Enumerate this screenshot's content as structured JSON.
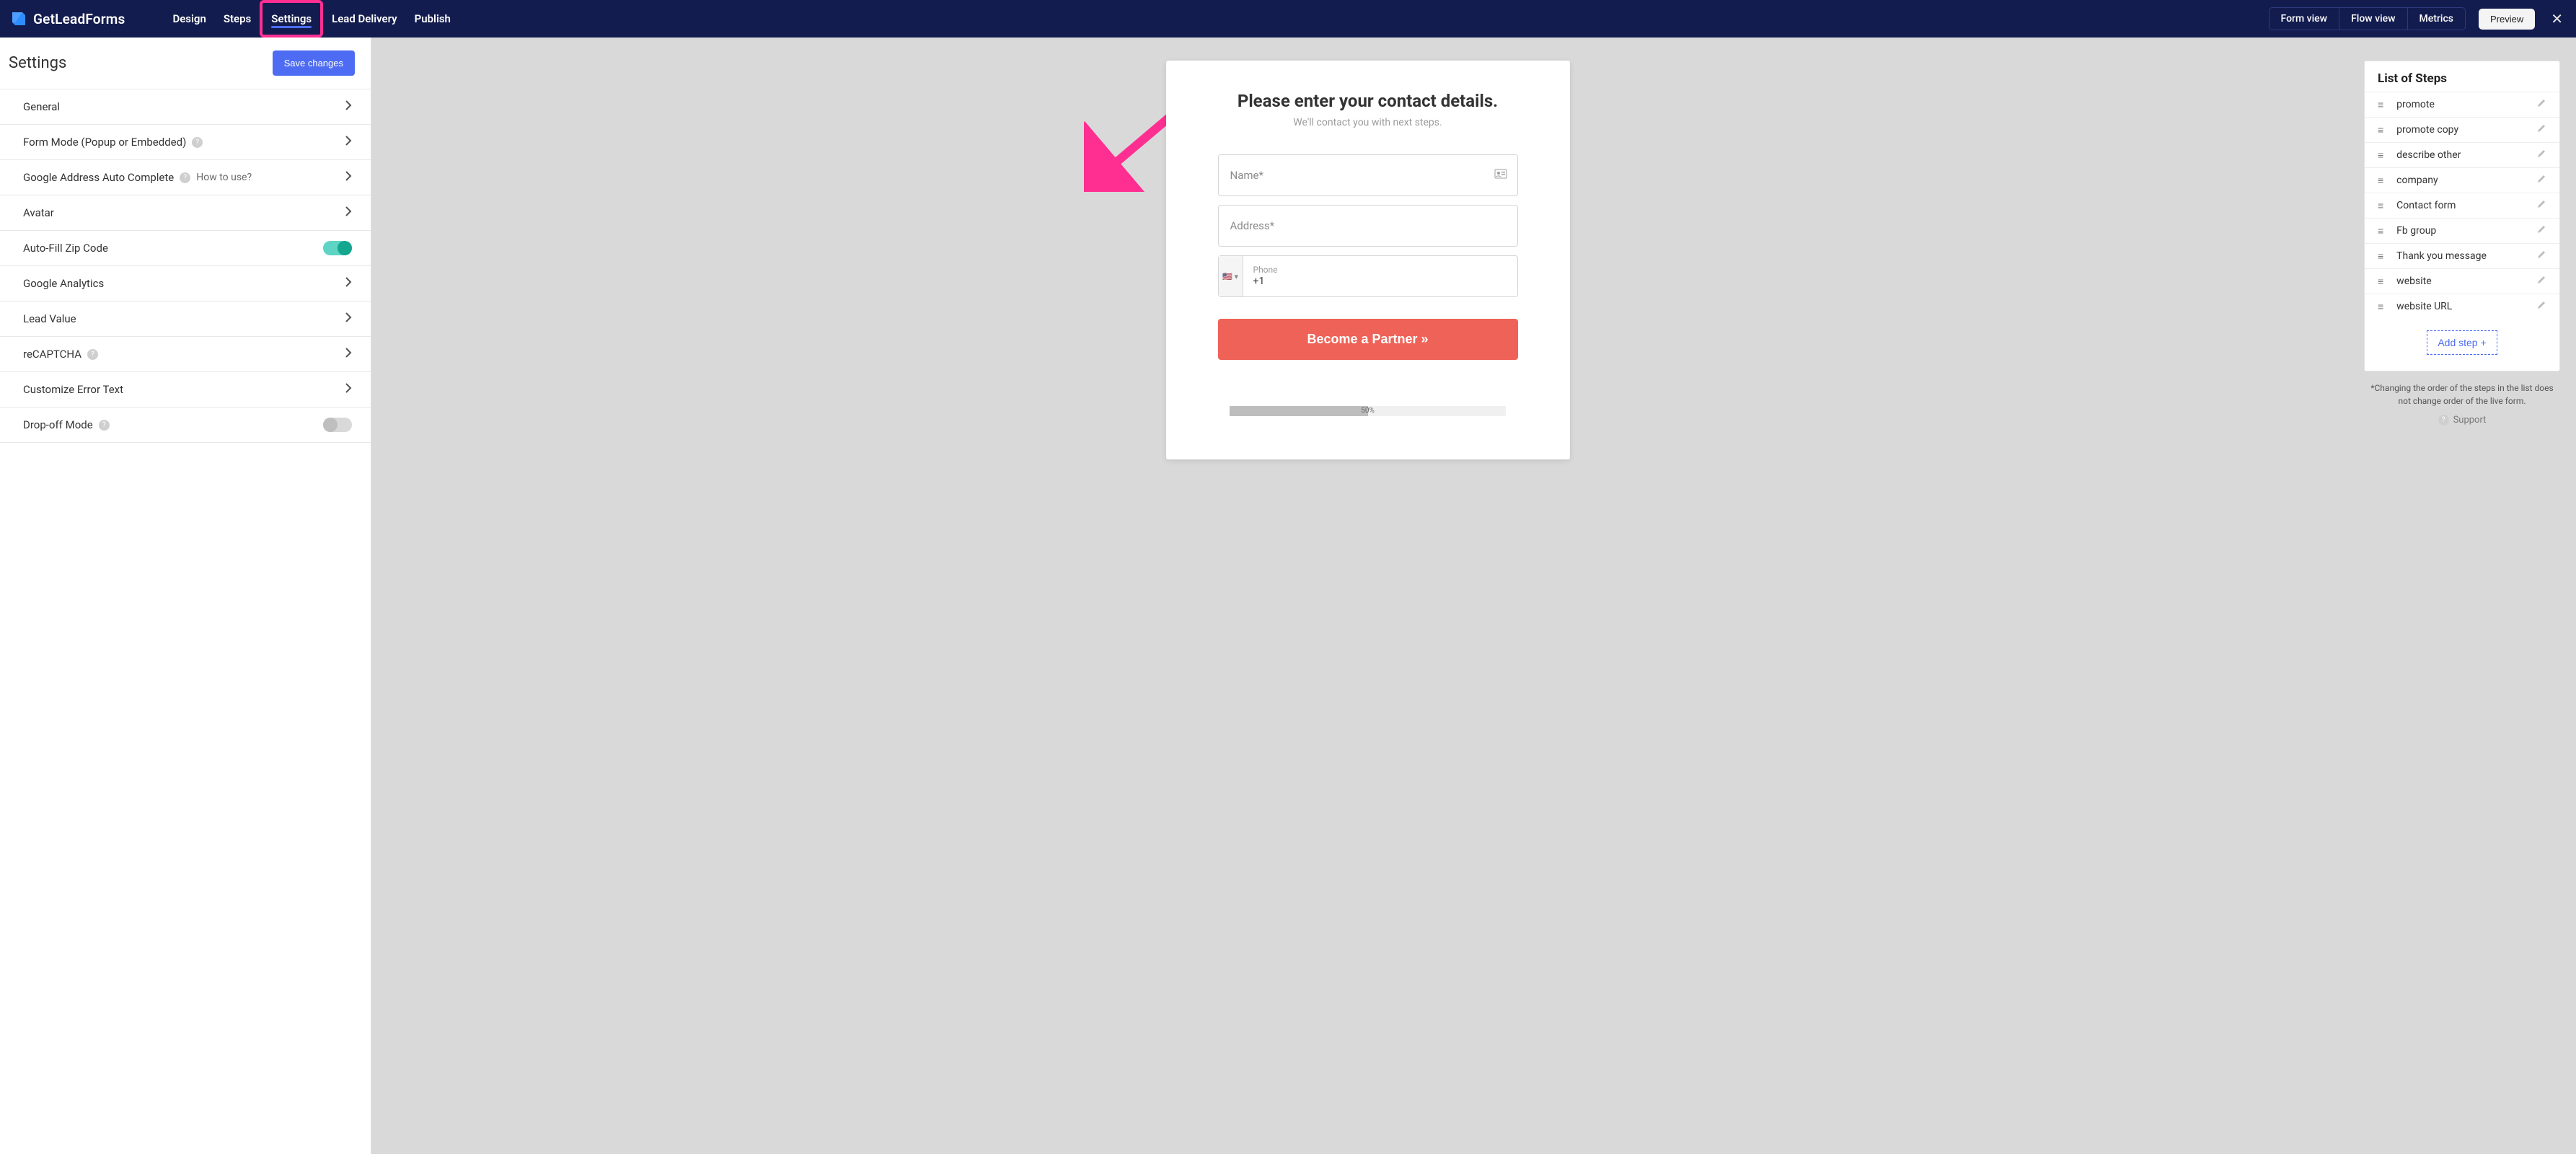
{
  "brand": "GetLeadForms",
  "nav": {
    "design": "Design",
    "steps": "Steps",
    "settings": "Settings",
    "lead_delivery": "Lead Delivery",
    "publish": "Publish"
  },
  "views": {
    "form": "Form view",
    "flow": "Flow view",
    "metrics": "Metrics"
  },
  "preview_btn": "Preview",
  "settings_panel": {
    "title": "Settings",
    "save_btn": "Save changes",
    "rows": {
      "general": "General",
      "form_mode": "Form Mode (Popup or Embedded)",
      "google_address": "Google Address Auto Complete",
      "google_address_howto": "How to use?",
      "avatar": "Avatar",
      "auto_zip": "Auto-Fill Zip Code",
      "ga": "Google Analytics",
      "lead_value": "Lead Value",
      "recaptcha": "reCAPTCHA",
      "custom_error": "Customize Error Text",
      "dropoff": "Drop-off Mode"
    }
  },
  "preview_card": {
    "heading": "Please enter your contact details.",
    "sub": "We'll contact you with next steps.",
    "name_ph": "Name*",
    "address_ph": "Address*",
    "phone_label": "Phone",
    "phone_value": "+1",
    "flag_dropdown": "🇺🇸 ▾",
    "cta": "Become a Partner »",
    "progress_pct": "50%"
  },
  "steps_list": {
    "title": "List of Steps",
    "items": [
      "promote",
      "promote copy",
      "describe other",
      "company",
      "Contact form",
      "Fb group",
      "Thank you message",
      "website",
      "website URL"
    ],
    "add_step": "Add step +",
    "hint": "*Changing the order of the steps in the list does not change order of the live form.",
    "support": "Support"
  }
}
